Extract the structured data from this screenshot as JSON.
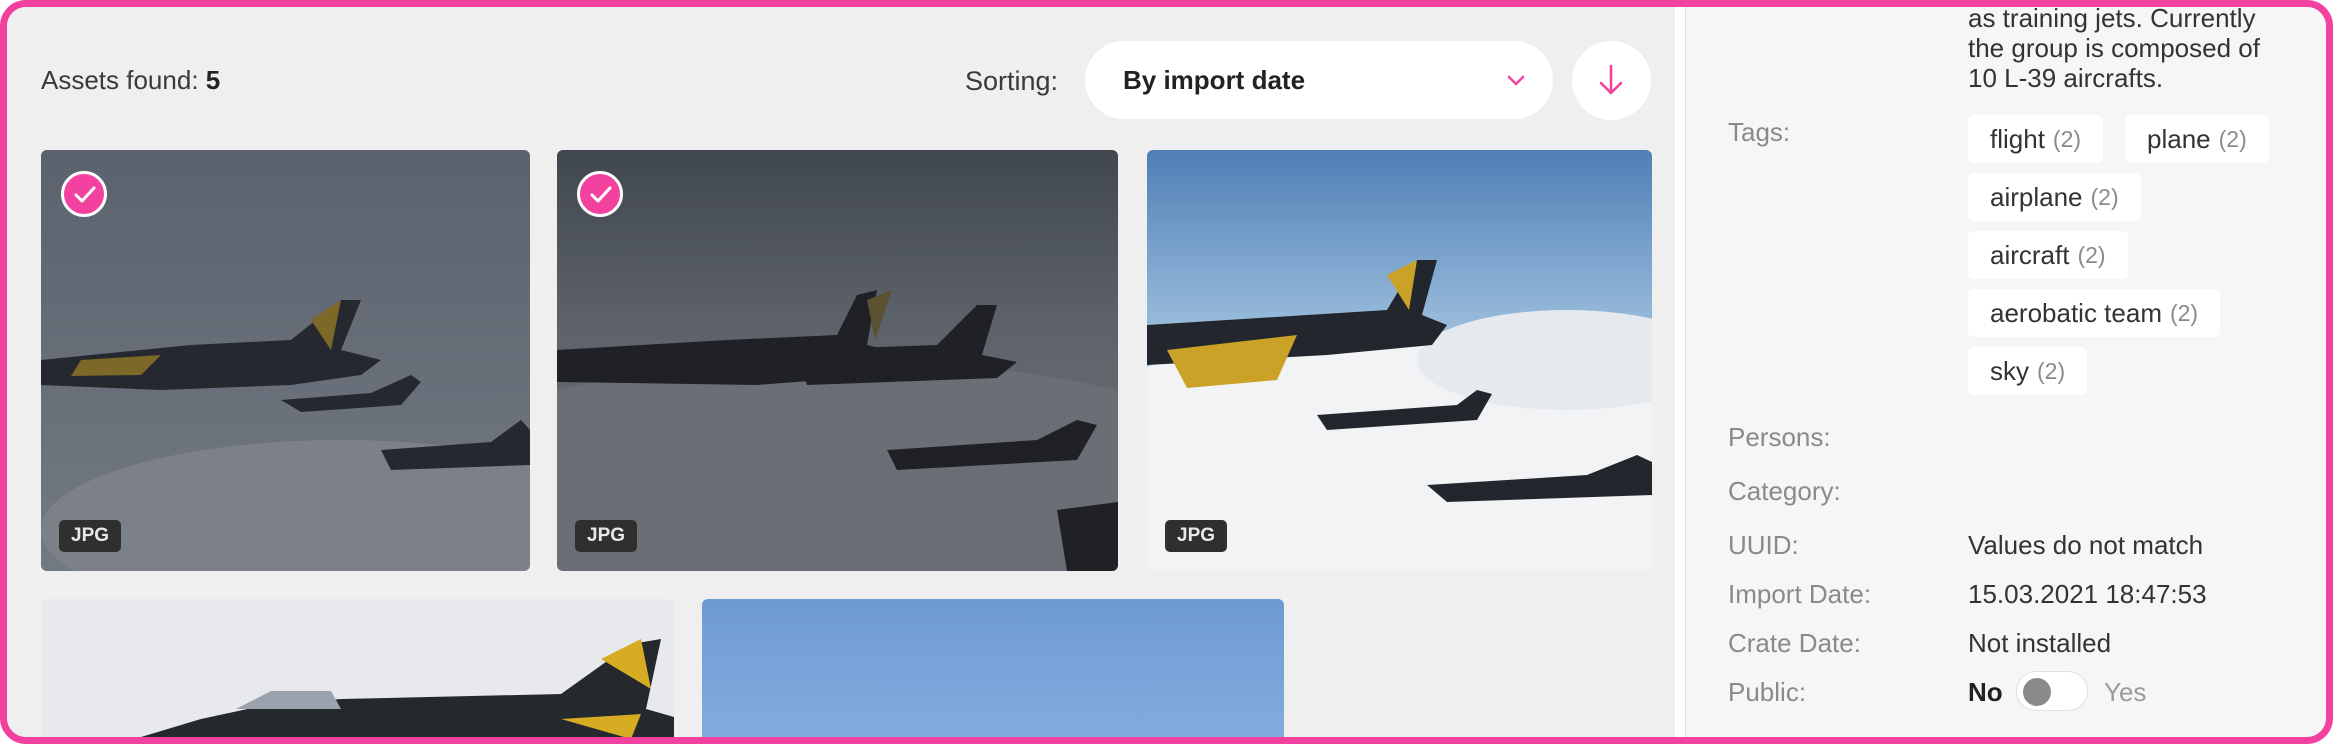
{
  "assets": {
    "label": "Assets found:",
    "count": "5"
  },
  "sorting": {
    "label": "Sorting:",
    "selected": "By import date"
  },
  "grid": [
    {
      "badge": "JPG",
      "selected": true
    },
    {
      "badge": "JPG",
      "selected": true
    },
    {
      "badge": "JPG",
      "selected": false
    },
    {
      "badge": "",
      "selected": false
    },
    {
      "badge": "",
      "selected": false
    }
  ],
  "details": {
    "description_lines": [
      "as training jets. Currently",
      "the group is composed of",
      "10 L-39 aircrafts."
    ],
    "tags_label": "Tags:",
    "tags": [
      {
        "name": "flight",
        "count": "(2)"
      },
      {
        "name": "plane",
        "count": "(2)"
      },
      {
        "name": "airplane",
        "count": "(2)"
      },
      {
        "name": "aircraft",
        "count": "(2)"
      },
      {
        "name": "aerobatic team",
        "count": "(2)"
      },
      {
        "name": "sky",
        "count": "(2)"
      }
    ],
    "persons_label": "Persons:",
    "category_label": "Category:",
    "uuid_label": "UUID:",
    "uuid_value": "Values do not match",
    "import_label": "Import Date:",
    "import_value": "15.03.2021 18:47:53",
    "create_label": "Crate Date:",
    "create_value": "Not installed",
    "public_label": "Public:",
    "public_no": "No",
    "public_yes": "Yes"
  },
  "colors": {
    "accent": "#f2419f",
    "panel": "#efefef",
    "sidebar": "#f6f6f6"
  }
}
